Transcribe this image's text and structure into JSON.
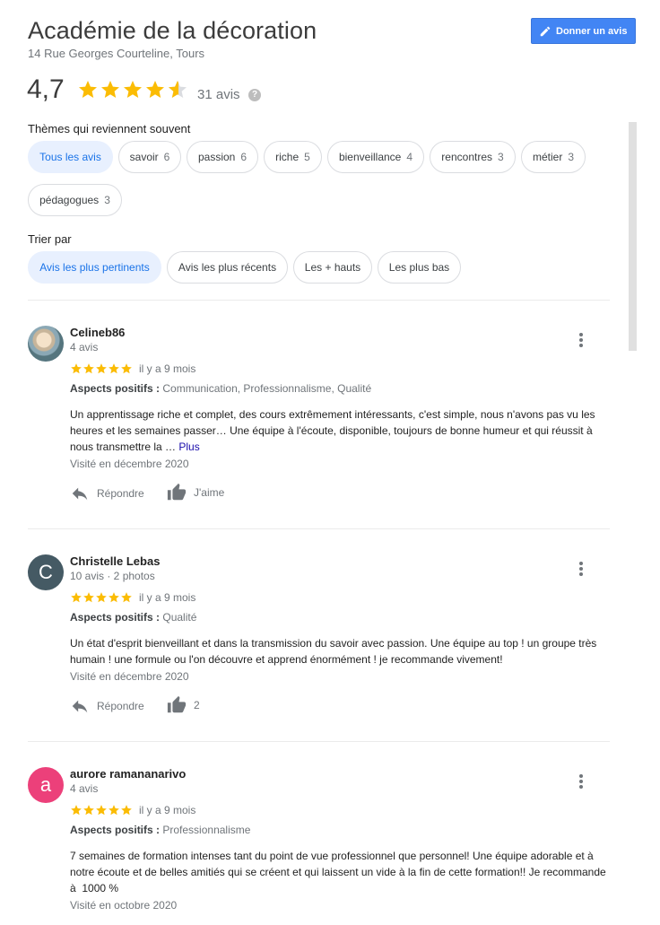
{
  "place": {
    "name": "Académie de la décoration",
    "address": "14 Rue Georges Courteline, Tours"
  },
  "write_review_label": "Donner un avis",
  "summary": {
    "rating": "4,7",
    "stars": 4.7,
    "count": "31 avis",
    "help_glyph": "?"
  },
  "themes": {
    "label": "Thèmes qui reviennent souvent",
    "chips": [
      {
        "label": "Tous les avis",
        "count": ""
      },
      {
        "label": "savoir",
        "count": "6"
      },
      {
        "label": "passion",
        "count": "6"
      },
      {
        "label": "riche",
        "count": "5"
      },
      {
        "label": "bienveillance",
        "count": "4"
      },
      {
        "label": "rencontres",
        "count": "3"
      },
      {
        "label": "métier",
        "count": "3"
      },
      {
        "label": "pédagogues",
        "count": "3"
      }
    ]
  },
  "sort": {
    "label": "Trier par",
    "options": [
      "Avis les plus pertinents",
      "Avis les plus récents",
      "Les + hauts",
      "Les plus bas"
    ]
  },
  "colors": {
    "accent": "#1a73e8",
    "star": "#fbbc04",
    "button": "#4285f4"
  },
  "reviews": [
    {
      "name": "Celineb86",
      "meta": "4 avis",
      "avatar_letter": "",
      "stars": 5,
      "date": "il y a 9 mois",
      "aspects_label": "Aspects positifs :",
      "aspects": "Communication, Professionnalisme, Qualité",
      "text": "Un apprentissage riche et complet, des cours extrêmement intéressants, c'est simple, nous n'avons pas vu les heures et les semaines passer… Une équipe à l'écoute, disponible, toujours de bonne humeur et qui réussit à nous transmettre la … ",
      "more": "Plus",
      "visited": "Visité en décembre 2020",
      "reply": "Répondre",
      "like": "J'aime"
    },
    {
      "name": "Christelle Lebas",
      "meta": "10 avis · 2 photos",
      "avatar_letter": "C",
      "avatar_color": "#455a64",
      "stars": 5,
      "date": "il y a 9 mois",
      "aspects_label": "Aspects positifs :",
      "aspects": "Qualité",
      "text": "Un état d'esprit bienveillant et dans la transmission du savoir avec passion. Une équipe au top ! un groupe très humain ! une formule ou l'on découvre et apprend énormément ! je recommande vivement!",
      "visited": "Visité en décembre 2020",
      "reply": "Répondre",
      "like": "2"
    },
    {
      "name": "aurore ramananarivo",
      "meta": "4 avis",
      "avatar_letter": "a",
      "avatar_color": "#ec407a",
      "stars": 5,
      "date": "il y a 9 mois",
      "aspects_label": "Aspects positifs :",
      "aspects": "Professionnalisme",
      "text": "7 semaines de formation intenses tant du point de vue professionnel que personnel! Une équipe adorable et à notre écoute et de belles amitiés qui se créent et qui laissent un vide à la fin de cette formation!! Je recommande à  1000 %",
      "visited": "Visité en octobre 2020"
    }
  ]
}
